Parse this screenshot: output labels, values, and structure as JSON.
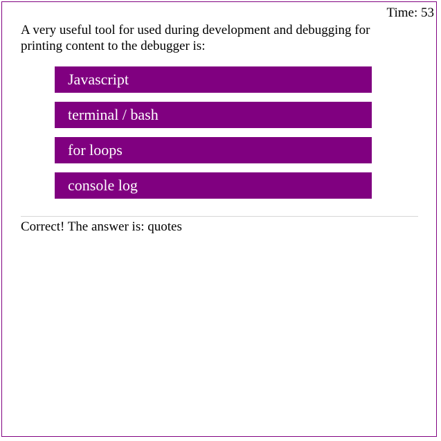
{
  "timer": {
    "text": "Time: 53"
  },
  "question": {
    "text": "A very useful tool for used during development and debugging for printing content to the debugger is:"
  },
  "choices": [
    {
      "label": "Javascript"
    },
    {
      "label": "terminal / bash"
    },
    {
      "label": "for loops"
    },
    {
      "label": "console log"
    }
  ],
  "result": {
    "text": "Correct! The answer is: quotes"
  },
  "colors": {
    "accent": "#800080",
    "choice_text": "#ffffff",
    "divider": "#d6d6d6"
  }
}
